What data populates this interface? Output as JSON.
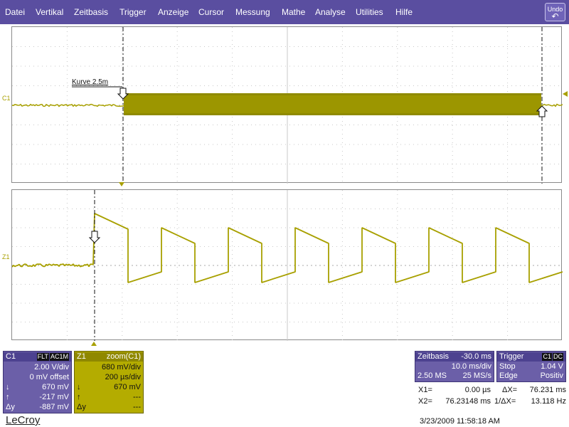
{
  "menu": {
    "items": [
      "Datei",
      "Vertikal",
      "Zeitbasis",
      "Trigger",
      "Anzeige",
      "Cursor",
      "Messung",
      "Mathe",
      "Analyse",
      "Utilities",
      "Hilfe"
    ],
    "undo_label": "Undo"
  },
  "colors": {
    "menu_bg": "#5a4ea0",
    "trace": "#a8a000",
    "descriptor_purple": "#6b5fa8",
    "descriptor_yellow": "#b4ac00",
    "grid_dots": "#888888"
  },
  "top_grid": {
    "channel_label": "C1",
    "annotation": "Kurve 2.5m"
  },
  "bottom_grid": {
    "channel_label": "Z1"
  },
  "c1": {
    "name": "C1",
    "tag1": "FLT",
    "tag2": "AC1M",
    "vdiv": "2.00 V/div",
    "offset": "0 mV offset",
    "down_arrow": "↓",
    "down_val": "670 mV",
    "up_arrow": "↑",
    "up_val": "-217 mV",
    "dy_label": "Δy",
    "dy_val": "-887 mV"
  },
  "z1": {
    "name": "Z1",
    "source": "zoom(C1)",
    "vdiv": "680 mV/div",
    "tdiv": "200 µs/div",
    "down_arrow": "↓",
    "down_val": "670 mV",
    "up_arrow": "↑",
    "up_val": "---",
    "dy_label": "Δy",
    "dy_val": "---"
  },
  "timebase": {
    "title": "Zeitbasis",
    "delay": "-30.0 ms",
    "tdiv": "10.0 ms/div",
    "samples": "2.50 MS",
    "rate": "25 MS/s"
  },
  "trigger": {
    "title": "Trigger",
    "src": "C1",
    "coupling": "DC",
    "mode": "Stop",
    "level": "1.04 V",
    "type": "Edge",
    "slope": "Positiv"
  },
  "cursor_readout": {
    "x1_label": "X1=",
    "x1_val": "0.00 µs",
    "dx_label": "ΔX=",
    "dx_val": "76.231 ms",
    "x2_label": "X2=",
    "x2_val": "76.23148 ms",
    "invdx_label": "1/ΔX=",
    "invdx_val": "13.118 Hz"
  },
  "footer": {
    "logo": "LeCroy",
    "timestamp": "3/23/2009 11:58:18 AM"
  }
}
